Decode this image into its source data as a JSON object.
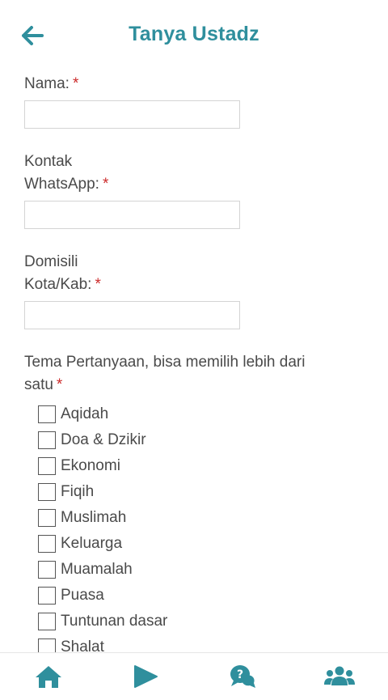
{
  "header": {
    "title": "Tanya Ustadz",
    "back_icon": "arrow-left-icon"
  },
  "colors": {
    "accent": "#2f8f9d",
    "required": "#cc2b2b",
    "text": "#4a4a4a",
    "input_border": "#d4d4d4"
  },
  "form": {
    "required_mark": "*",
    "nama": {
      "label": "Nama:",
      "value": ""
    },
    "kontak": {
      "label": "Kontak WhatsApp:",
      "value": ""
    },
    "domisili": {
      "label": "Domisili Kota/Kab:",
      "value": ""
    },
    "tema": {
      "label": "Tema Pertanyaan, bisa memilih lebih dari satu",
      "options": [
        {
          "label": "Aqidah",
          "checked": false
        },
        {
          "label": "Doa & Dzikir",
          "checked": false
        },
        {
          "label": "Ekonomi",
          "checked": false
        },
        {
          "label": "Fiqih",
          "checked": false
        },
        {
          "label": "Muslimah",
          "checked": false
        },
        {
          "label": "Keluarga",
          "checked": false
        },
        {
          "label": "Muamalah",
          "checked": false
        },
        {
          "label": "Puasa",
          "checked": false
        },
        {
          "label": "Tuntunan dasar",
          "checked": false
        },
        {
          "label": "Shalat",
          "checked": false
        }
      ]
    }
  },
  "bottom_nav": {
    "items": [
      {
        "icon": "home-icon"
      },
      {
        "icon": "play-icon"
      },
      {
        "icon": "question-chat-icon"
      },
      {
        "icon": "users-icon"
      }
    ]
  }
}
